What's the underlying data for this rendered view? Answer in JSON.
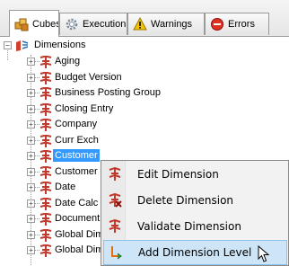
{
  "tabs": [
    {
      "label": "Cubes",
      "icon": "cubes-icon",
      "active": true
    },
    {
      "label": "Execution",
      "icon": "gear-icon",
      "active": false
    },
    {
      "label": "Warnings",
      "icon": "warning-icon",
      "active": false
    },
    {
      "label": "Errors",
      "icon": "error-icon",
      "active": false
    }
  ],
  "tree": {
    "root": "Dimensions",
    "items": [
      "Aging",
      "Budget Version",
      "Business Posting Group",
      "Closing Entry",
      "Company",
      "Curr Exch",
      "Customer",
      "Customer",
      "Date",
      "Date Calc",
      "Document",
      "Global Dim",
      "Global Dim"
    ],
    "selected_index": 6
  },
  "context_menu": {
    "items": [
      {
        "label": "Edit Dimension",
        "icon": "dimension-icon"
      },
      {
        "label": "Delete Dimension",
        "icon": "delete-dimension-icon"
      },
      {
        "label": "Validate Dimension",
        "icon": "validate-dimension-icon"
      },
      {
        "label": "Add Dimension Level",
        "icon": "add-level-icon"
      }
    ],
    "highlighted_index": 3
  },
  "colors": {
    "selection": "#3399ff",
    "menu_highlight": "#cde5f7",
    "dimension_icon": "#c0392b"
  }
}
